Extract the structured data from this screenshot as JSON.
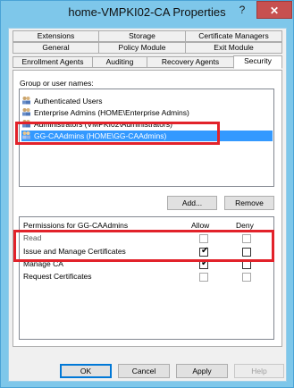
{
  "window": {
    "title": "home-VMPKI02-CA Properties",
    "help_glyph": "?",
    "close_glyph": "✕"
  },
  "tabs": {
    "row1": [
      "Extensions",
      "Storage",
      "Certificate Managers"
    ],
    "row2": [
      "General",
      "Policy Module",
      "Exit Module"
    ],
    "row3": [
      "Enrollment Agents",
      "Auditing",
      "Recovery Agents",
      "Security"
    ],
    "active": "Security"
  },
  "security": {
    "groups_label": "Group or user names:",
    "users": [
      "Authenticated Users",
      "Enterprise Admins (HOME\\Enterprise Admins)",
      "Administrators (VMPKI02\\Administrators)",
      "GG-CAAdmins (HOME\\GG-CAAdmins)"
    ],
    "selected_user": "GG-CAAdmins (HOME\\GG-CAAdmins)",
    "add_label": "Add...",
    "remove_label": "Remove",
    "permissions_label": "Permissions for GG-CAAdmins",
    "allow_header": "Allow",
    "deny_header": "Deny",
    "permissions": [
      {
        "name": "Read",
        "allow": false,
        "deny": false
      },
      {
        "name": "Issue and Manage Certificates",
        "allow": true,
        "deny": false
      },
      {
        "name": "Manage CA",
        "allow": true,
        "deny": false
      },
      {
        "name": "Request Certificates",
        "allow": false,
        "deny": false
      }
    ]
  },
  "footer": {
    "ok_label": "OK",
    "cancel_label": "Cancel",
    "apply_label": "Apply",
    "help_label": "Help"
  },
  "colors": {
    "titlebar": "#7ec7ea",
    "selection": "#3399ff",
    "highlight_box": "#e2222a"
  }
}
